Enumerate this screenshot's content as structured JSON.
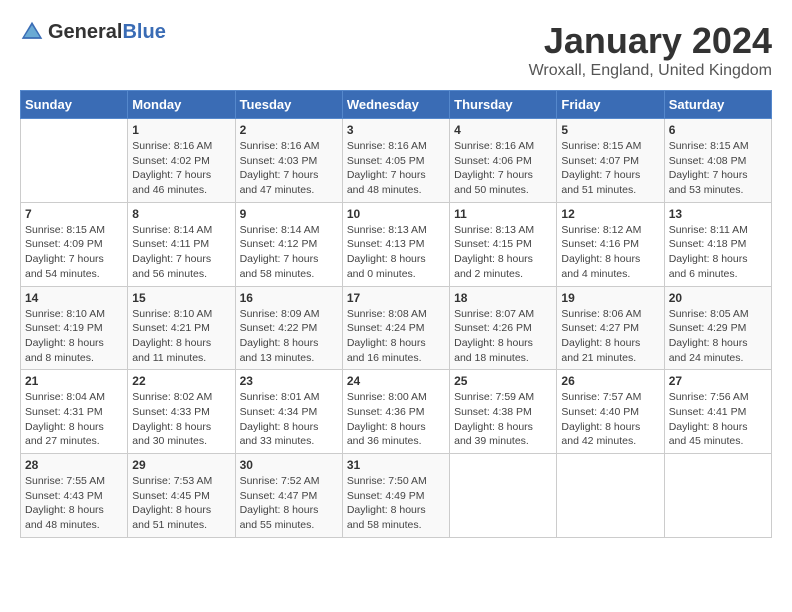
{
  "header": {
    "logo_general": "General",
    "logo_blue": "Blue",
    "month": "January 2024",
    "location": "Wroxall, England, United Kingdom"
  },
  "days_of_week": [
    "Sunday",
    "Monday",
    "Tuesday",
    "Wednesday",
    "Thursday",
    "Friday",
    "Saturday"
  ],
  "weeks": [
    [
      {
        "day": "",
        "content": ""
      },
      {
        "day": "1",
        "content": "Sunrise: 8:16 AM\nSunset: 4:02 PM\nDaylight: 7 hours\nand 46 minutes."
      },
      {
        "day": "2",
        "content": "Sunrise: 8:16 AM\nSunset: 4:03 PM\nDaylight: 7 hours\nand 47 minutes."
      },
      {
        "day": "3",
        "content": "Sunrise: 8:16 AM\nSunset: 4:05 PM\nDaylight: 7 hours\nand 48 minutes."
      },
      {
        "day": "4",
        "content": "Sunrise: 8:16 AM\nSunset: 4:06 PM\nDaylight: 7 hours\nand 50 minutes."
      },
      {
        "day": "5",
        "content": "Sunrise: 8:15 AM\nSunset: 4:07 PM\nDaylight: 7 hours\nand 51 minutes."
      },
      {
        "day": "6",
        "content": "Sunrise: 8:15 AM\nSunset: 4:08 PM\nDaylight: 7 hours\nand 53 minutes."
      }
    ],
    [
      {
        "day": "7",
        "content": "Sunrise: 8:15 AM\nSunset: 4:09 PM\nDaylight: 7 hours\nand 54 minutes."
      },
      {
        "day": "8",
        "content": "Sunrise: 8:14 AM\nSunset: 4:11 PM\nDaylight: 7 hours\nand 56 minutes."
      },
      {
        "day": "9",
        "content": "Sunrise: 8:14 AM\nSunset: 4:12 PM\nDaylight: 7 hours\nand 58 minutes."
      },
      {
        "day": "10",
        "content": "Sunrise: 8:13 AM\nSunset: 4:13 PM\nDaylight: 8 hours\nand 0 minutes."
      },
      {
        "day": "11",
        "content": "Sunrise: 8:13 AM\nSunset: 4:15 PM\nDaylight: 8 hours\nand 2 minutes."
      },
      {
        "day": "12",
        "content": "Sunrise: 8:12 AM\nSunset: 4:16 PM\nDaylight: 8 hours\nand 4 minutes."
      },
      {
        "day": "13",
        "content": "Sunrise: 8:11 AM\nSunset: 4:18 PM\nDaylight: 8 hours\nand 6 minutes."
      }
    ],
    [
      {
        "day": "14",
        "content": "Sunrise: 8:10 AM\nSunset: 4:19 PM\nDaylight: 8 hours\nand 8 minutes."
      },
      {
        "day": "15",
        "content": "Sunrise: 8:10 AM\nSunset: 4:21 PM\nDaylight: 8 hours\nand 11 minutes."
      },
      {
        "day": "16",
        "content": "Sunrise: 8:09 AM\nSunset: 4:22 PM\nDaylight: 8 hours\nand 13 minutes."
      },
      {
        "day": "17",
        "content": "Sunrise: 8:08 AM\nSunset: 4:24 PM\nDaylight: 8 hours\nand 16 minutes."
      },
      {
        "day": "18",
        "content": "Sunrise: 8:07 AM\nSunset: 4:26 PM\nDaylight: 8 hours\nand 18 minutes."
      },
      {
        "day": "19",
        "content": "Sunrise: 8:06 AM\nSunset: 4:27 PM\nDaylight: 8 hours\nand 21 minutes."
      },
      {
        "day": "20",
        "content": "Sunrise: 8:05 AM\nSunset: 4:29 PM\nDaylight: 8 hours\nand 24 minutes."
      }
    ],
    [
      {
        "day": "21",
        "content": "Sunrise: 8:04 AM\nSunset: 4:31 PM\nDaylight: 8 hours\nand 27 minutes."
      },
      {
        "day": "22",
        "content": "Sunrise: 8:02 AM\nSunset: 4:33 PM\nDaylight: 8 hours\nand 30 minutes."
      },
      {
        "day": "23",
        "content": "Sunrise: 8:01 AM\nSunset: 4:34 PM\nDaylight: 8 hours\nand 33 minutes."
      },
      {
        "day": "24",
        "content": "Sunrise: 8:00 AM\nSunset: 4:36 PM\nDaylight: 8 hours\nand 36 minutes."
      },
      {
        "day": "25",
        "content": "Sunrise: 7:59 AM\nSunset: 4:38 PM\nDaylight: 8 hours\nand 39 minutes."
      },
      {
        "day": "26",
        "content": "Sunrise: 7:57 AM\nSunset: 4:40 PM\nDaylight: 8 hours\nand 42 minutes."
      },
      {
        "day": "27",
        "content": "Sunrise: 7:56 AM\nSunset: 4:41 PM\nDaylight: 8 hours\nand 45 minutes."
      }
    ],
    [
      {
        "day": "28",
        "content": "Sunrise: 7:55 AM\nSunset: 4:43 PM\nDaylight: 8 hours\nand 48 minutes."
      },
      {
        "day": "29",
        "content": "Sunrise: 7:53 AM\nSunset: 4:45 PM\nDaylight: 8 hours\nand 51 minutes."
      },
      {
        "day": "30",
        "content": "Sunrise: 7:52 AM\nSunset: 4:47 PM\nDaylight: 8 hours\nand 55 minutes."
      },
      {
        "day": "31",
        "content": "Sunrise: 7:50 AM\nSunset: 4:49 PM\nDaylight: 8 hours\nand 58 minutes."
      },
      {
        "day": "",
        "content": ""
      },
      {
        "day": "",
        "content": ""
      },
      {
        "day": "",
        "content": ""
      }
    ]
  ]
}
